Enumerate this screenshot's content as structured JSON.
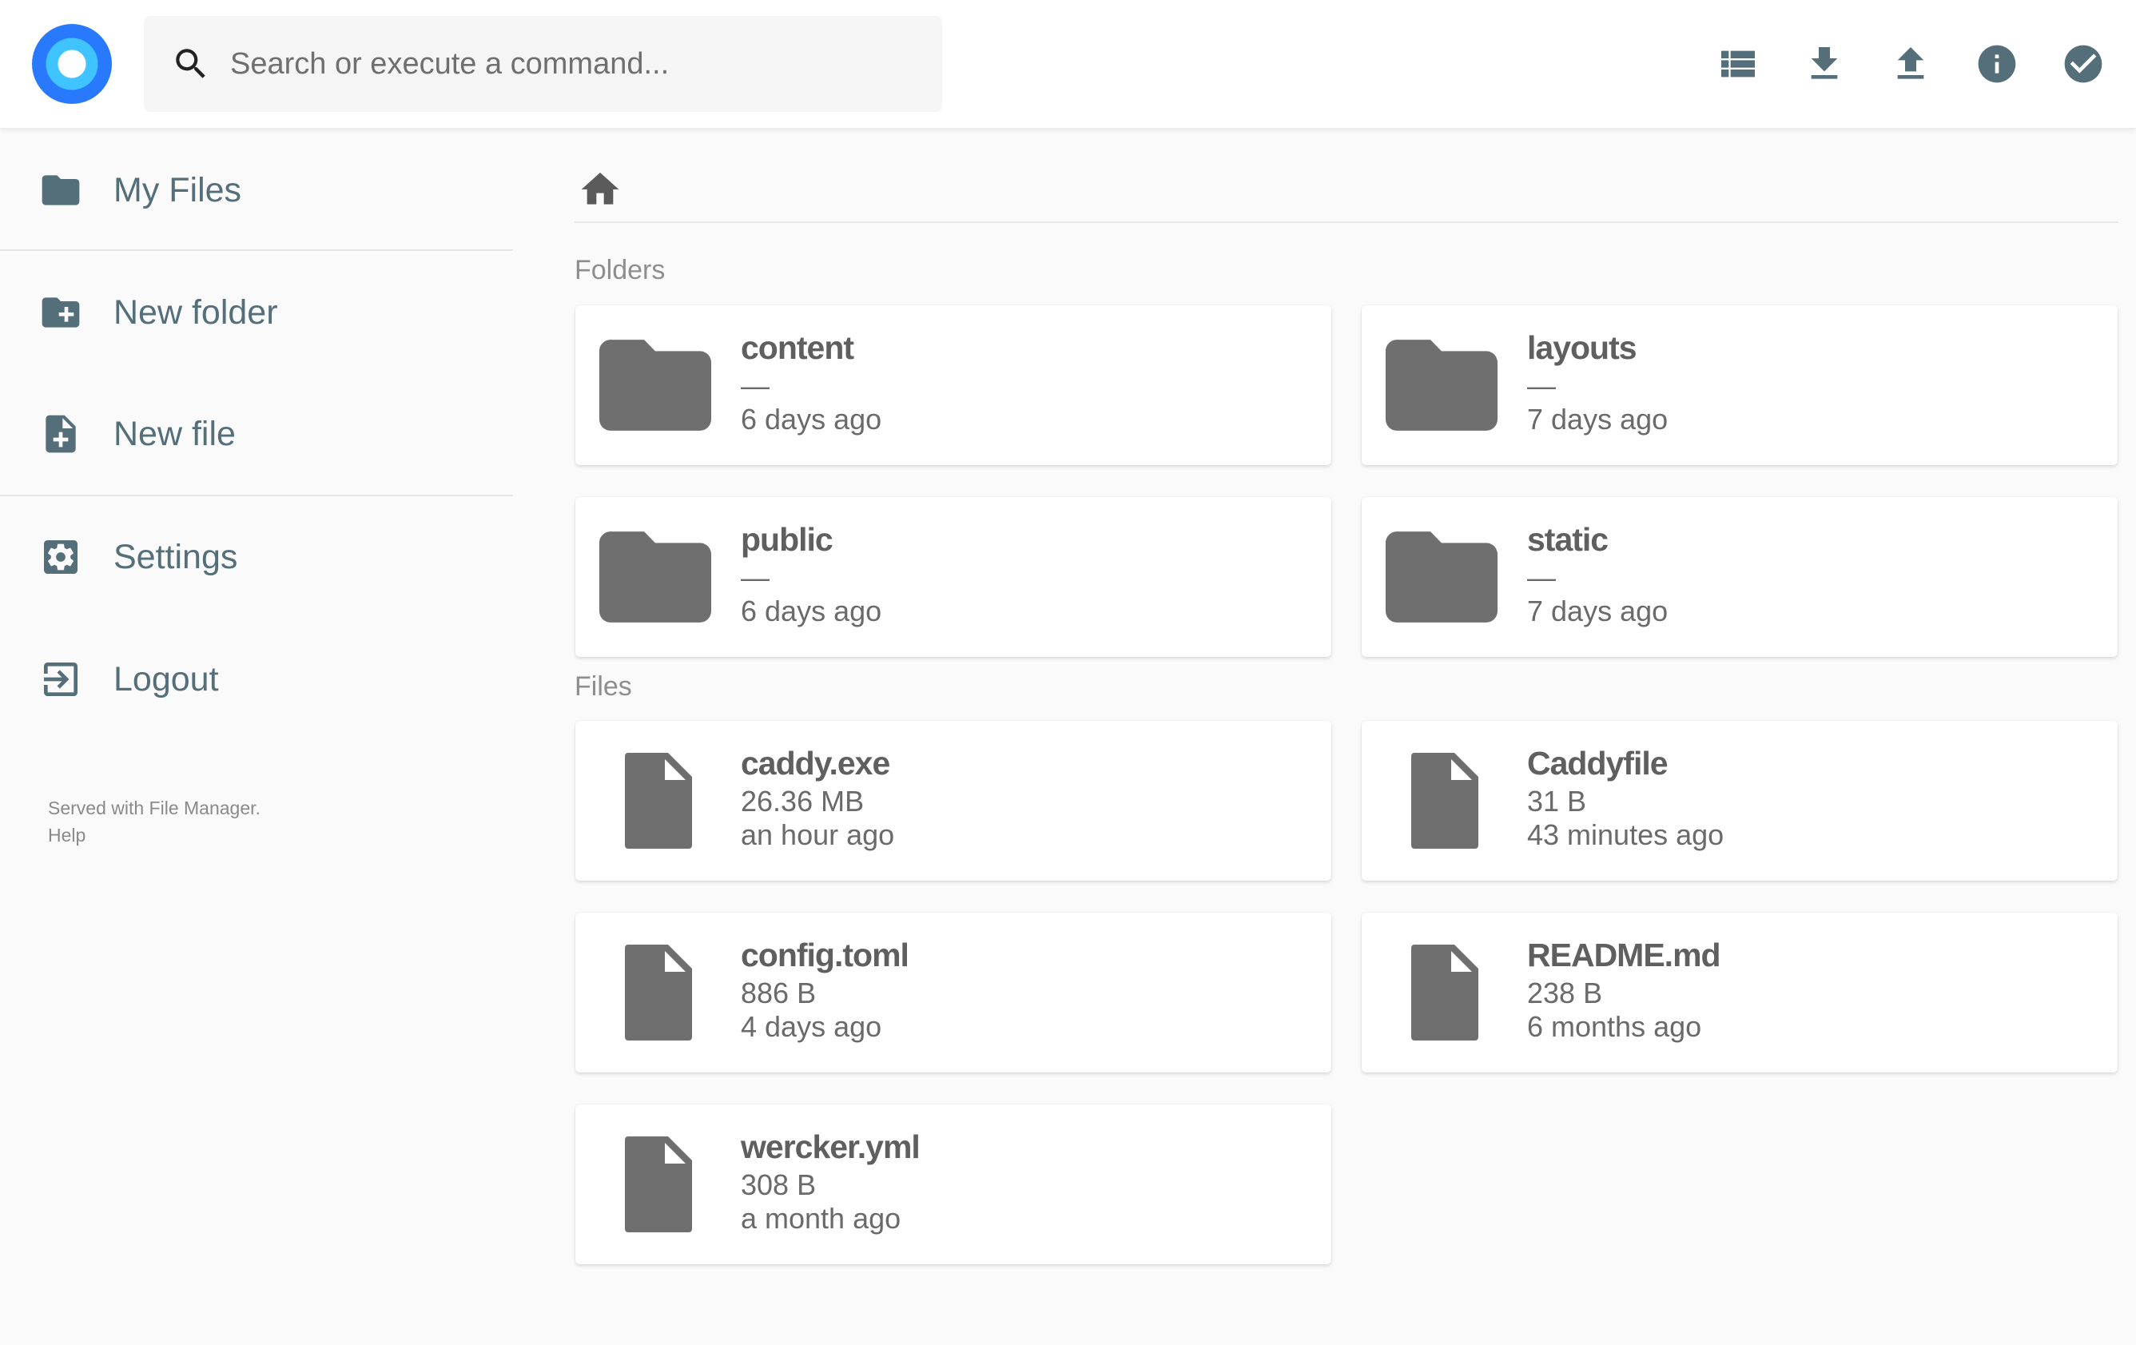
{
  "header": {
    "search_placeholder": "Search or execute a command...",
    "actions": [
      {
        "name": "view-toggle",
        "icon": "view-list-icon"
      },
      {
        "name": "download",
        "icon": "download-icon"
      },
      {
        "name": "upload",
        "icon": "upload-icon"
      },
      {
        "name": "info",
        "icon": "info-icon"
      },
      {
        "name": "select",
        "icon": "check-circle-icon"
      }
    ]
  },
  "sidebar": {
    "items": [
      {
        "label": "My Files",
        "icon": "folder-icon"
      },
      {
        "label": "New folder",
        "icon": "folder-add-icon"
      },
      {
        "label": "New file",
        "icon": "file-add-icon"
      },
      {
        "label": "Settings",
        "icon": "settings-icon"
      },
      {
        "label": "Logout",
        "icon": "logout-icon"
      }
    ],
    "credits": {
      "served_with": "Served with File Manager.",
      "help": "Help"
    }
  },
  "main": {
    "breadcrumb_icon": "home-icon",
    "folders_title": "Folders",
    "files_title": "Files",
    "folders": [
      {
        "name": "content",
        "size": "—",
        "modified": "6 days ago"
      },
      {
        "name": "layouts",
        "size": "—",
        "modified": "7 days ago"
      },
      {
        "name": "public",
        "size": "—",
        "modified": "6 days ago"
      },
      {
        "name": "static",
        "size": "—",
        "modified": "7 days ago"
      }
    ],
    "files": [
      {
        "name": "caddy.exe",
        "size": "26.36 MB",
        "modified": "an hour ago"
      },
      {
        "name": "Caddyfile",
        "size": "31 B",
        "modified": "43 minutes ago"
      },
      {
        "name": "config.toml",
        "size": "886 B",
        "modified": "4 days ago"
      },
      {
        "name": "README.md",
        "size": "238 B",
        "modified": "6 months ago"
      },
      {
        "name": "wercker.yml",
        "size": "308 B",
        "modified": "a month ago"
      }
    ]
  },
  "colors": {
    "sidebar_text": "#546e7a",
    "logo_outer": "#2979ff",
    "logo_inner": "#40c4ff",
    "item_icon": "#6f6f6f"
  }
}
